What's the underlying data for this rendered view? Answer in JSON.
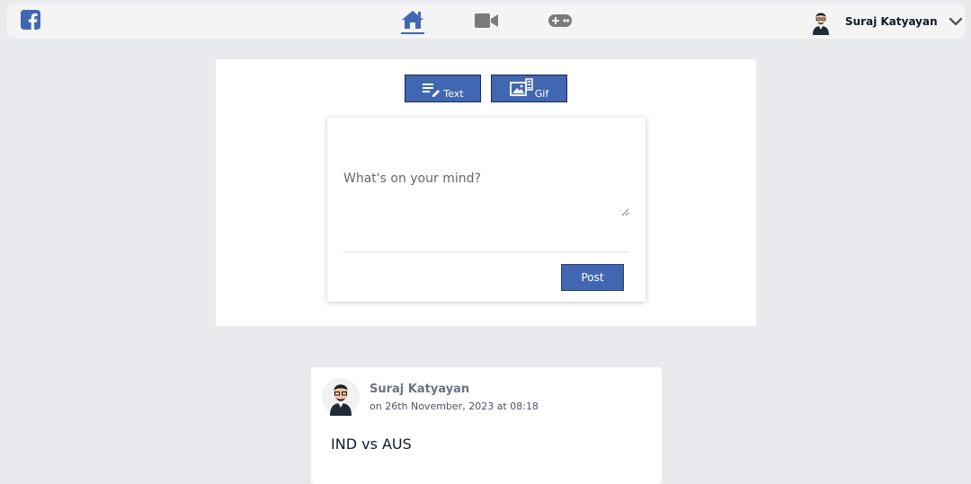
{
  "navbar": {
    "user": {
      "name": "Suraj Katyayan"
    },
    "icons": [
      "facebook-logo",
      "home-icon",
      "video-icon",
      "gamepad-icon",
      "chevron-down-icon"
    ]
  },
  "composer": {
    "text_button_label": "Text",
    "gif_button_label": "Gif",
    "placeholder": "What's on your mind?",
    "post_button_label": "Post"
  },
  "feed": {
    "posts": [
      {
        "author": "Suraj Katyayan",
        "meta": "on 26th November, 2023 at 08:18",
        "text": "IND vs AUS"
      }
    ]
  },
  "colors": {
    "accent": "#4267b2",
    "page_bg": "#e9eaed",
    "navbar_bg": "#f4f4f5",
    "icon_gray": "#7a7a7a"
  }
}
